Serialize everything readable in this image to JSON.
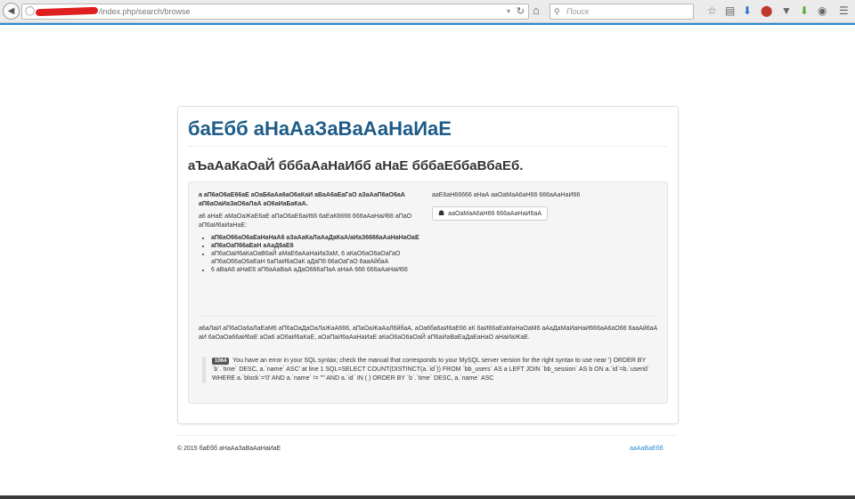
{
  "browser": {
    "url_path": "/index.php/search/browse",
    "search_placeholder": "Поиск",
    "icons": [
      "back-arrow-icon",
      "globe-icon",
      "dropdown-icon",
      "reload-icon",
      "home-icon",
      "search-icon",
      "star-icon",
      "reader-icon",
      "download-icon",
      "adblock-icon",
      "shield-icon",
      "green-arrow-icon",
      "chat-icon",
      "menu-icon"
    ]
  },
  "colors": {
    "accent": "#1d5b88",
    "link": "#2a8ad4",
    "host_redaction": "#e02020"
  },
  "page": {
    "site_title": "бaЕбб аНаАаЗаВаАаНаИаЕ",
    "heading": "аЪаАаКаОаЙ бббаАаНаИбб аНаЕ бббаЕббаВбаЕб.",
    "intro_bold": "а аП6аО6аЕ66аЕ аОаБ6аАа6аО6аКаИ аВаА6аЕаГаО аЗаАаП6аО6аА аП6аОаИаЗаО6аЛаА аО6аИаБаКаА.",
    "intro_normal": "а6 аНаЕ аМаОаЖаЕ6аЕ аПаО6аЕ6аИ66 6аЕаК6666 666аАаНаИ66 аПаО аП6аИ6аИаНаЕ:",
    "reasons": [
      "аП6аО66аО6аЕаНаНаА6 аЗаАаКаЛаАаДаКаА/аИаЗ6666аАаНаНаОаЕ",
      "аП6аОаП66аЕаН аАаД6аЕ6",
      "аП6аОаИ6аКаОаВ6аЙ аМаЕ6аАаНаИаЗаМ, 6 аКаО6аО6аОаГаО аП6аО66аО6аЕаН 6аПаИ6аОаК аДаП6 66аОаГаО 6ааАйбаА",
      "6 аВаА6 аНаЕ6 аП6аАаВаА аДаО666аПаА аНаА 666 666аАаНаИ66"
    ],
    "right_text": "ааЕ6аН66666 аНаА ааОаМаА6аН66 666аАаНаИ66",
    "home_button_label": "ааОаМаА6аН66 666аАаНаИ6аА",
    "explain_text": "а6аЛаИ аП6аОа6аЛаЕаМ6 аП6аОаДаОаЛаЖаА666, аПаОаЖаАаЛ6йбаА, аОа6ба6аИ6аЕ66 аК 6аИ66аЕаМаНаОаМ6 аАаДаМаИаНаИ666аА6аО66 6ааАй6аА аИ 6аОаОа66аИ6аЕ аОа6 аО6аИ6аКаЕ, аОаПаИ6аАаНаИаЕ аКаО6аО6аОаЙ аП6аИаВаЕаДаЕаНаО аНаИаЖаЕ.",
    "error": {
      "code": "1064",
      "message": "You have an error in your SQL syntax; check the manual that corresponds to your MySQL server version for the right syntax to use near ') ORDER BY `b`.`time` DESC, a.`name` ASC' at line 1 SQL=SELECT COUNT(DISTINCT(a.`id`)) FROM `bb_users` AS a LEFT JOIN `bb_session` AS b ON a.`id`=b.`userid` WHERE a.`block`='0' AND a.`name` != \"\" AND a.`id` IN ( ) ORDER BY `b`.`time` DESC, a.`name` ASC"
    }
  },
  "footer": {
    "copyright": "© 2015 баЕбб аНаАаЗаВаАаНаИаЕ",
    "link": "ааАаВаЕбб"
  }
}
